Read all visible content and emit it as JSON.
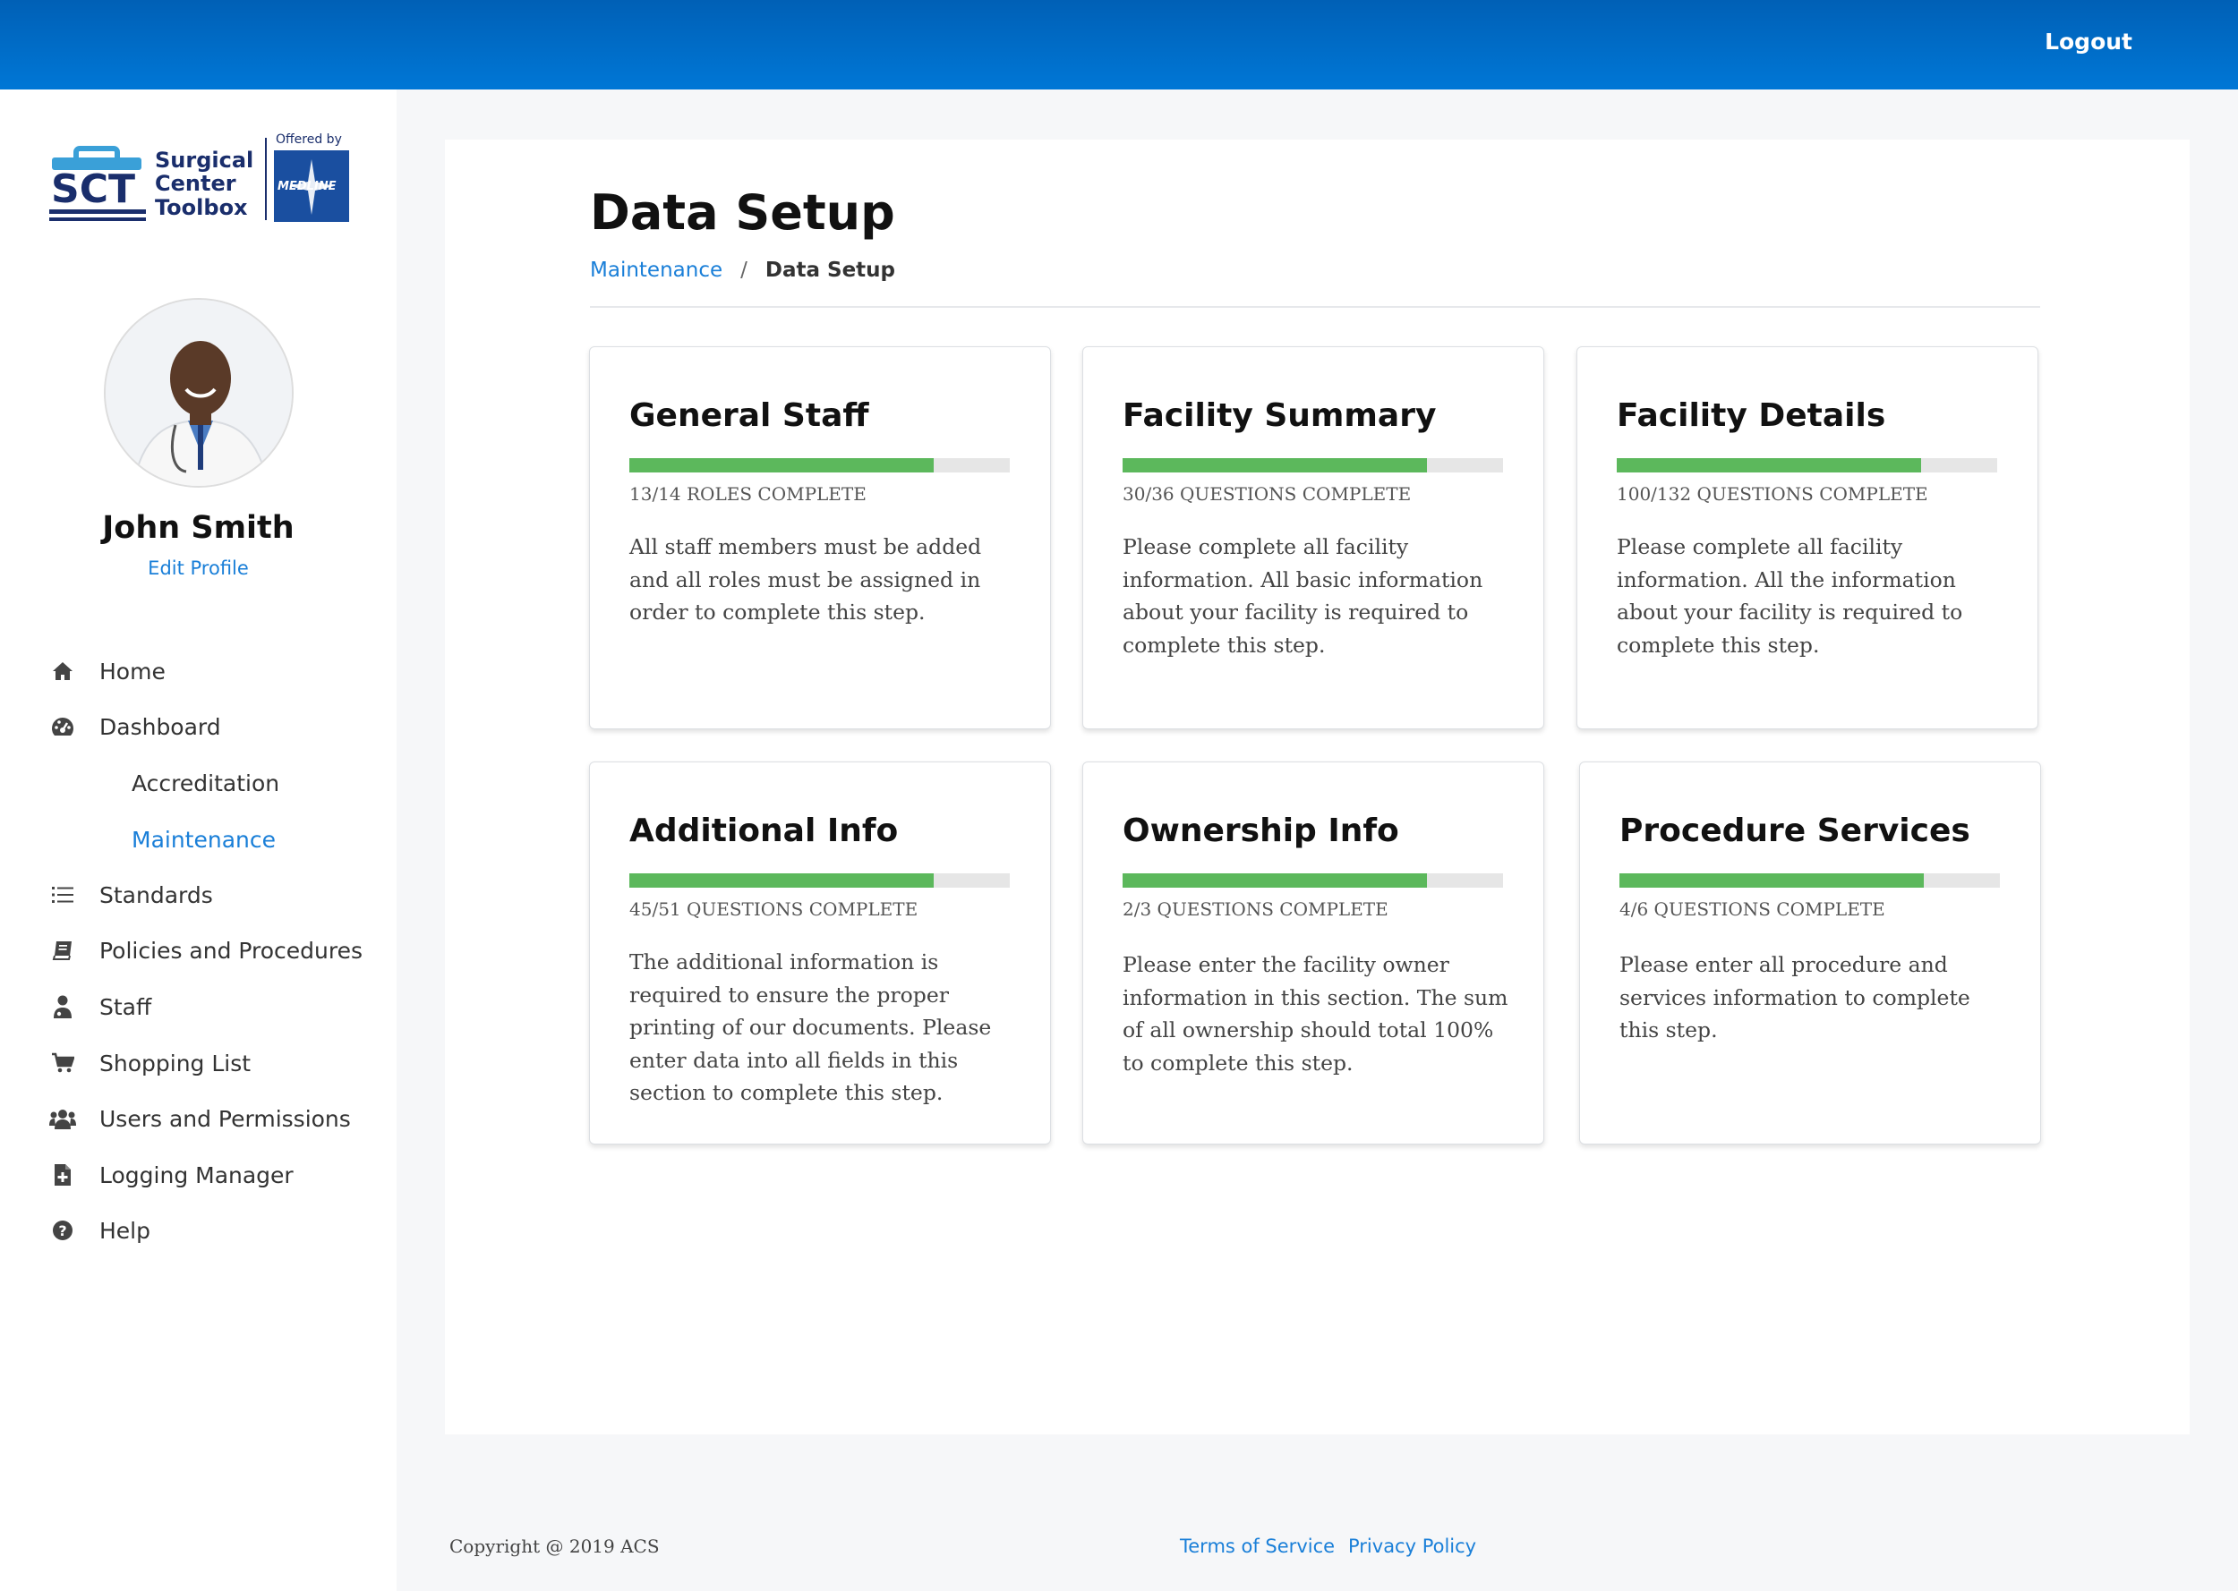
{
  "header": {
    "logout_label": "Logout"
  },
  "logo": {
    "offered_by": "Offered by",
    "line1": "Surgical",
    "line2": "Center",
    "line3": "Toolbox",
    "abbr": "SCT",
    "partner": "MEDLINE"
  },
  "user": {
    "name": "John Smith",
    "edit_label": "Edit Profile"
  },
  "nav": [
    {
      "label": "Home",
      "icon": "home-icon"
    },
    {
      "label": "Dashboard",
      "icon": "dashboard-icon"
    },
    {
      "label": "Accreditation",
      "icon": ""
    },
    {
      "label": "Maintenance",
      "icon": "",
      "active": true
    },
    {
      "label": "Standards",
      "icon": "list-icon"
    },
    {
      "label": "Policies and Procedures",
      "icon": "book-icon"
    },
    {
      "label": "Staff",
      "icon": "staff-icon"
    },
    {
      "label": "Shopping List",
      "icon": "cart-icon"
    },
    {
      "label": "Users and Permissions",
      "icon": "users-icon"
    },
    {
      "label": "Logging Manager",
      "icon": "file-plus-icon"
    },
    {
      "label": "Help",
      "icon": "help-icon"
    }
  ],
  "page": {
    "title": "Data Setup",
    "breadcrumb": {
      "parent": "Maintenance",
      "separator": "/",
      "current": "Data Setup"
    }
  },
  "cards": [
    {
      "title": "General Staff",
      "progress": 0.8,
      "progress_label": "13/14 ROLES COMPLETE",
      "description": "All staff members must be added and all roles must be assigned in order to complete this step."
    },
    {
      "title": "Facility Summary",
      "progress": 0.8,
      "progress_label": "30/36 QUESTIONS COMPLETE",
      "description": "Please complete all facility information. All basic information about your facility is required to complete this step."
    },
    {
      "title": "Facility Details",
      "progress": 0.8,
      "progress_label": "100/132 QUESTIONS COMPLETE",
      "description": "Please complete all facility information. All the information about your facility is required to complete this step."
    },
    {
      "title": "Additional Info",
      "progress": 0.8,
      "progress_label": "45/51 QUESTIONS COMPLETE",
      "description": "The additional information is required to ensure the proper printing of our documents. Please enter data into all fields in this section to complete this step."
    },
    {
      "title": "Ownership Info",
      "progress": 0.8,
      "progress_label": "2/3 QUESTIONS COMPLETE",
      "description": "Please enter the facility owner information in this section. The sum of all ownership should total 100% to complete this step."
    },
    {
      "title": "Procedure Services",
      "progress": 0.8,
      "progress_label": "4/6 QUESTIONS COMPLETE",
      "description": "Please enter all procedure and services information to complete this step."
    }
  ],
  "footer": {
    "copyright": "Copyright @ 2019 ACS",
    "terms_label": "Terms of Service",
    "privacy_label": "Privacy Policy"
  },
  "colors": {
    "header": "#0070cc",
    "accent": "#1a7fd8",
    "progress": "#5cb85c"
  }
}
